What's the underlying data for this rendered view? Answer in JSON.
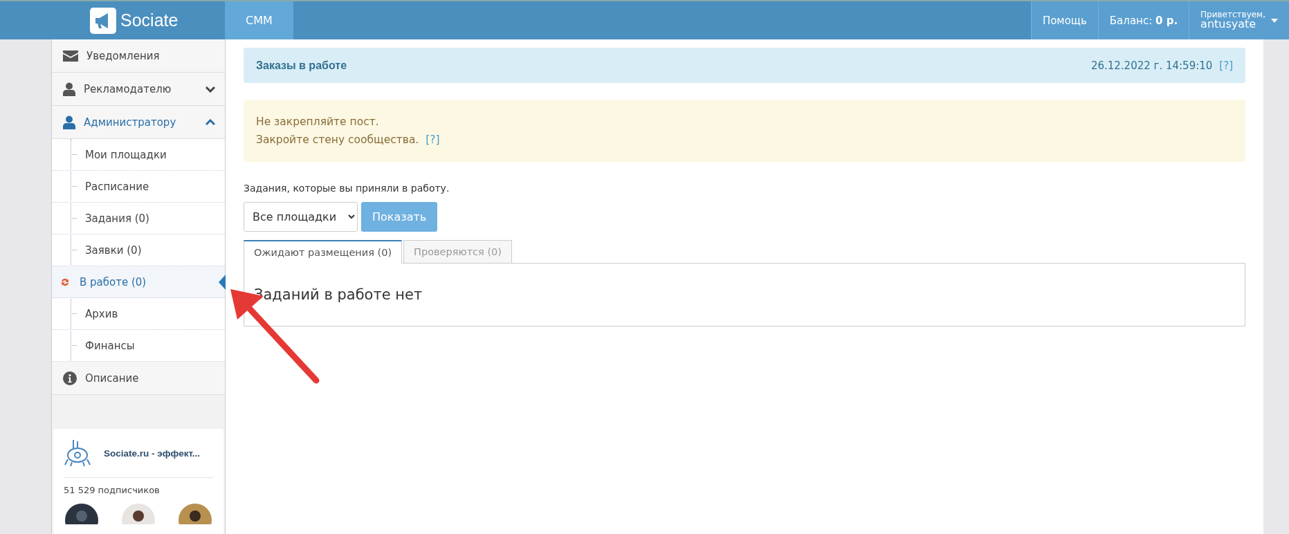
{
  "header": {
    "logo_text": "Sociate",
    "nav": [
      {
        "label": "CMM",
        "selected": true
      }
    ],
    "help": "Помощь",
    "balance_label": "Баланс:",
    "balance_value": "0 р.",
    "greeting": "Приветствуем,",
    "username": "antusyate"
  },
  "sidebar": {
    "items": [
      {
        "label": "Уведомления"
      },
      {
        "label": "Рекламодателю",
        "expanded": false
      },
      {
        "label": "Администратору",
        "expanded": true,
        "children": [
          {
            "label": "Мои площадки",
            "selected": false
          },
          {
            "label": "Расписание",
            "selected": false
          },
          {
            "label": "Задания (0)",
            "selected": false
          },
          {
            "label": "Заявки (0)",
            "selected": false
          },
          {
            "label": "В работе (0)",
            "selected": true
          },
          {
            "label": "Архив",
            "selected": false
          },
          {
            "label": "Финансы",
            "selected": false
          }
        ]
      },
      {
        "label": "Описание"
      }
    ],
    "widget": {
      "title": "Sociate.ru - эффект...",
      "subscribers": "51 529 подписчиков"
    }
  },
  "content": {
    "page_header": {
      "title": "Заказы в работе",
      "datetime": "26.12.2022 г. 14:59:10",
      "help": "[?]"
    },
    "alert": {
      "lines": [
        "Не закрепляйте пост.",
        "Закройте стену сообщества."
      ],
      "help": "[?]"
    },
    "intro": "Задания, которые вы приняли в работу.",
    "filter": {
      "value": "Все площадки",
      "button": "Показать"
    },
    "tabs": [
      {
        "label": "Ожидают размещения (0)",
        "selected": true
      },
      {
        "label": "Проверяются (0)",
        "selected": false
      }
    ],
    "empty_message": "Заданий в работе нет"
  }
}
